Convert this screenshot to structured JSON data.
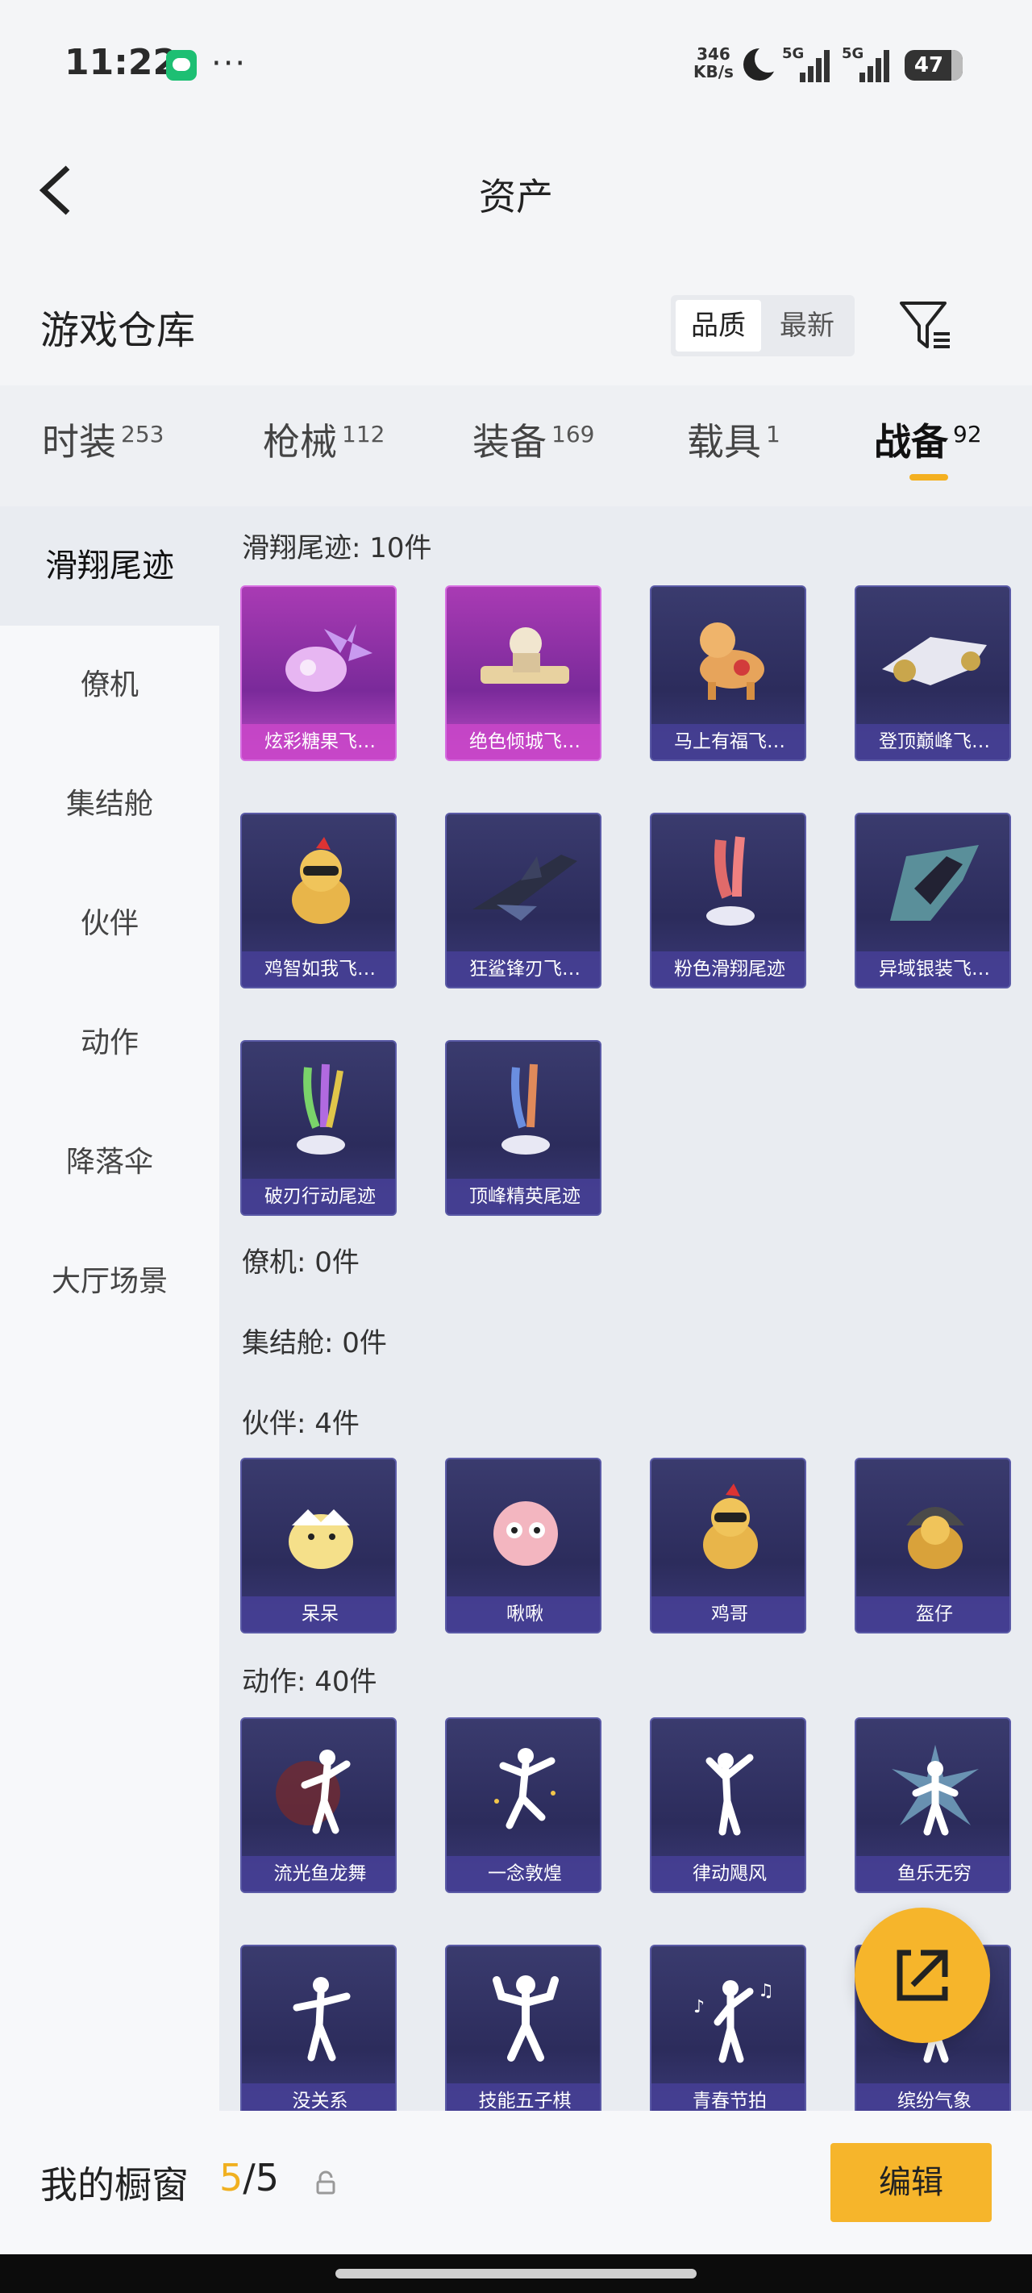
{
  "status_bar": {
    "time": "11:22",
    "net_speed_value": "346",
    "net_speed_unit": "KB/s",
    "sig1_label": "5G",
    "sig2_label": "5G",
    "battery": "47"
  },
  "header": {
    "title": "资产"
  },
  "warehouse": {
    "title": "游戏仓库",
    "sort_options": [
      "品质",
      "最新"
    ],
    "sort_selected": "品质"
  },
  "tabs": [
    {
      "label": "时装",
      "count": "253"
    },
    {
      "label": "枪械",
      "count": "112"
    },
    {
      "label": "装备",
      "count": "169"
    },
    {
      "label": "载具",
      "count": "1"
    },
    {
      "label": "战备",
      "count": "92"
    }
  ],
  "active_tab": "战备",
  "sidebar": [
    "滑翔尾迹",
    "僚机",
    "集结舱",
    "伙伴",
    "动作",
    "降落伞",
    "大厅场景"
  ],
  "sections": {
    "glide_trail": {
      "title": "滑翔尾迹: 10件",
      "items": [
        "炫彩糖果飞…",
        "绝色倾城飞…",
        "马上有福飞…",
        "登顶巅峰飞…",
        "鸡智如我飞…",
        "狂鲨锋刃飞…",
        "粉色滑翔尾迹",
        "异域银装飞…",
        "破刃行动尾迹",
        "顶峰精英尾迹"
      ]
    },
    "wingman": {
      "title": "僚机: 0件"
    },
    "assembly_pod": {
      "title": "集结舱: 0件"
    },
    "companion": {
      "title": "伙伴: 4件",
      "items": [
        "呆呆",
        "啾啾",
        "鸡哥",
        "盔仔"
      ]
    },
    "emote": {
      "title": "动作: 40件",
      "items": [
        "流光鱼龙舞",
        "一念敦煌",
        "律动飓风",
        "鱼乐无穷",
        "没关系",
        "技能五子棋",
        "青春节拍",
        "缤纷气象"
      ]
    }
  },
  "bottom_bar": {
    "title": "我的橱窗",
    "current": "5",
    "separator": "/",
    "total": "5",
    "edit_label": "编辑"
  },
  "colors": {
    "accent": "#f6b52b",
    "card_purple": "#2c2c5c",
    "card_pink": "#a93bb4"
  }
}
